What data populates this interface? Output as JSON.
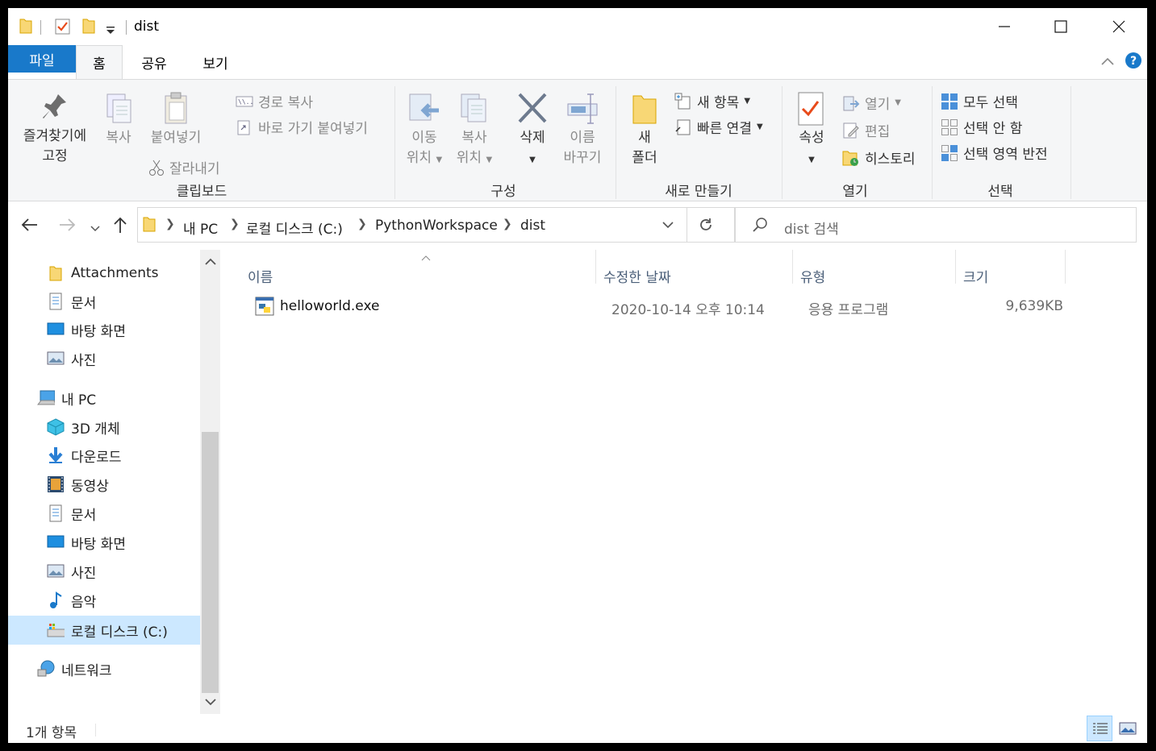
{
  "window": {
    "title": "dist",
    "controls": {
      "minimize": "minimize-icon",
      "maximize": "maximize-icon",
      "close": "close-icon"
    }
  },
  "tabs": [
    {
      "label": "파일"
    },
    {
      "label": "홈"
    },
    {
      "label": "공유"
    },
    {
      "label": "보기"
    }
  ],
  "ribbon": {
    "clipboard": {
      "label": "클립보드",
      "pin_line1": "즐겨찾기에",
      "pin_line2": "고정",
      "copy": "복사",
      "paste": "붙여넣기",
      "copy_path": "경로 복사",
      "paste_shortcut": "바로 가기 붙여넣기",
      "cut": "잘라내기"
    },
    "organize": {
      "label": "구성",
      "move_line1": "이동",
      "move_line2": "위치",
      "copyto_line1": "복사",
      "copyto_line2": "위치",
      "delete": "삭제",
      "rename_line1": "이름",
      "rename_line2": "바꾸기"
    },
    "new": {
      "label": "새로 만들기",
      "folder_line1": "새",
      "folder_line2": "폴더",
      "new_item": "새 항목",
      "easy_access": "빠른 연결"
    },
    "open": {
      "label": "열기",
      "properties": "속성",
      "open": "열기",
      "edit": "편집",
      "history": "히스토리"
    },
    "select": {
      "label": "선택",
      "select_all": "모두 선택",
      "select_none": "선택 안 함",
      "invert": "선택 영역 반전"
    }
  },
  "address": {
    "crumbs": [
      "내 PC",
      "로컬 디스크 (C:)",
      "PythonWorkspace",
      "dist"
    ],
    "search_placeholder": "dist 검색"
  },
  "nav": {
    "quick": [
      "Attachments",
      "문서",
      "바탕 화면",
      "사진"
    ],
    "this_pc": "내 PC",
    "pc_items": [
      "3D 개체",
      "다운로드",
      "동영상",
      "문서",
      "바탕 화면",
      "사진",
      "음악",
      "로컬 디스크 (C:)"
    ],
    "network": "네트워크"
  },
  "columns": [
    "이름",
    "수정한 날짜",
    "유형",
    "크기"
  ],
  "files": [
    {
      "name": "helloworld.exe",
      "modified": "2020-10-14 오후 10:14",
      "type": "응용 프로그램",
      "size": "9,639KB"
    }
  ],
  "status": {
    "count": "1개 항목"
  },
  "colors": {
    "accent": "#1979ca",
    "selection": "#cce8ff",
    "folder": "#f8d775"
  }
}
